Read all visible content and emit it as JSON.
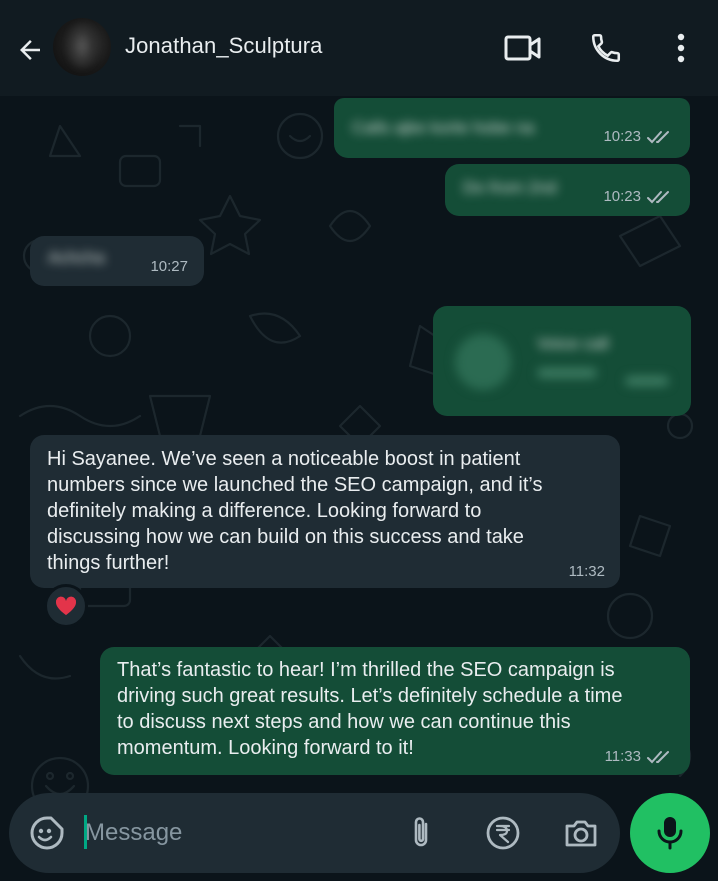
{
  "header": {
    "contact_name": "Jonathan_Sculptura",
    "icons": [
      "back-arrow-icon",
      "video-call-icon",
      "phone-icon",
      "more-vert-icon"
    ]
  },
  "messages": [
    {
      "direction": "outgoing",
      "text": "Calls ajke korte hobe na",
      "time": "10:23",
      "status": "read",
      "blurred": true
    },
    {
      "direction": "outgoing",
      "text": "Do from 2nd",
      "time": "10:23",
      "status": "read",
      "blurred": true
    },
    {
      "direction": "incoming",
      "text": "Achcha",
      "time": "10:27",
      "blurred": true
    },
    {
      "direction": "outgoing",
      "type": "call",
      "text": "Voice call",
      "blurred": true
    },
    {
      "direction": "incoming",
      "lines": [
        "Hi Sayanee. We’ve seen a noticeable boost in patient",
        "numbers since we launched the SEO campaign, and it’s",
        "definitely making a difference. Looking forward to",
        "discussing how we can build on this success and take",
        "things further!"
      ],
      "time": "11:32",
      "reaction": "❤️"
    },
    {
      "direction": "outgoing",
      "lines": [
        "That’s fantastic to hear! I’m thrilled the SEO campaign is",
        "driving such great results. Let’s definitely schedule a time",
        "to discuss next steps and how we can continue this",
        "momentum. Looking forward to it!"
      ],
      "time": "11:33",
      "status": "read"
    }
  ],
  "composer": {
    "placeholder": "Message",
    "value": "",
    "icons": [
      "sticker-icon",
      "attach-icon",
      "rupee-icon",
      "camera-icon",
      "mic-icon"
    ]
  },
  "colors": {
    "background": "#0b141a",
    "header": "#111b21",
    "outgoing_bubble": "#144d37",
    "incoming_bubble": "#1f2c34",
    "accent": "#21c063",
    "read_ticks": "#aebac1"
  }
}
